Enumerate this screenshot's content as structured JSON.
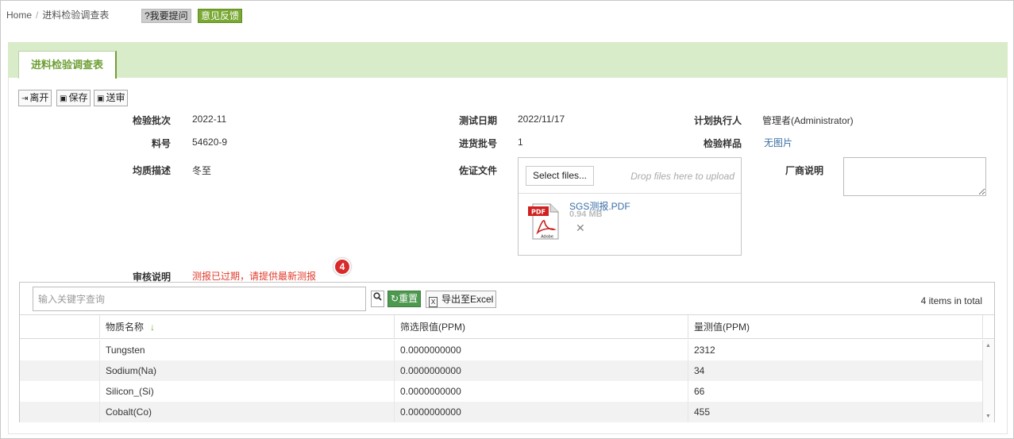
{
  "breadcrumb": {
    "home": "Home",
    "separator": "/",
    "current": "进料检验调查表"
  },
  "top_buttons": {
    "help": "?我要提问",
    "feedback": "意见反馈"
  },
  "tab": {
    "label": "进料检验调查表"
  },
  "toolbar": {
    "leave": "离开",
    "save": "保存",
    "submit": "送审"
  },
  "form": {
    "batch_label": "检验批次",
    "batch_value": "2022-11",
    "test_date_label": "测试日期",
    "test_date_value": "2022/11/17",
    "executor_label": "计划执行人",
    "executor_value": "管理者(Administrator)",
    "part_no_label": "料号",
    "part_no_value": "54620-9",
    "lot_label": "进货批号",
    "lot_value": "1",
    "sample_label": "检验样品",
    "sample_value": "无图片",
    "homogeneity_label": "均质描述",
    "homogeneity_value": "冬至",
    "evidence_label": "佐证文件",
    "vendor_note_label": "厂商说明",
    "review_label": "审核说明",
    "review_value": "测报已过期，请提供最新测报"
  },
  "upload": {
    "select_label": "Select files...",
    "drop_hint": "Drop files here to upload",
    "file_name": "SGS测报.PDF",
    "file_size": "0.94 MB",
    "remove": "✕"
  },
  "badge": {
    "value": "4"
  },
  "grid": {
    "search_placeholder": "输入关键字查询",
    "reset_label": "重置",
    "export_label": "导出至Excel",
    "total": "4 items in total",
    "columns": [
      "物质名称",
      "筛选限值(PPM)",
      "量测值(PPM)"
    ],
    "sort_arrow": "↓",
    "rows": [
      {
        "name": "Tungsten",
        "limit": "0.0000000000",
        "measured": "2312"
      },
      {
        "name": "Sodium(Na)",
        "limit": "0.0000000000",
        "measured": "34"
      },
      {
        "name": "Silicon_(Si)",
        "limit": "0.0000000000",
        "measured": "66"
      },
      {
        "name": "Cobalt(Co)",
        "limit": "0.0000000000",
        "measured": "455"
      }
    ]
  },
  "colors": {
    "accent_green": "#79a833",
    "tab_bg": "#d9ecc9",
    "alert_red": "#e03b2b"
  }
}
